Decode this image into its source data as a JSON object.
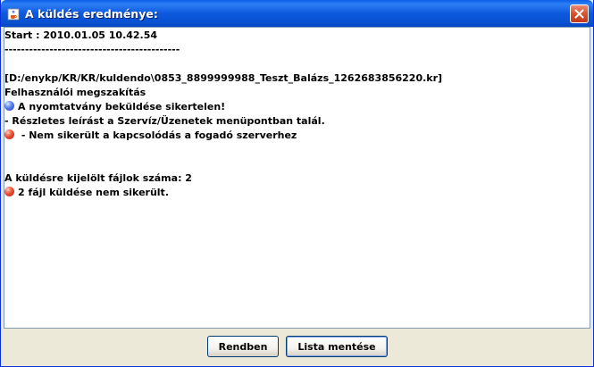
{
  "window": {
    "title": "A küldés eredménye:"
  },
  "log": {
    "lines": [
      {
        "text": "Start : 2010.01.05 10.42.54",
        "icon": null
      },
      {
        "text": "-------------------------------------------",
        "icon": null
      },
      {
        "text": "",
        "icon": null
      },
      {
        "text": "[D:/enykp/KR/KR/kuldendo\\0853_8899999988_Teszt_Balázs_1262683856220.kr]",
        "icon": null
      },
      {
        "text": "Felhasználói megszakítás",
        "icon": null
      },
      {
        "text": "A nyomtatvány beküldése sikertelen!",
        "icon": "blue-dot"
      },
      {
        "text": " - Részletes leírást a Szervíz/Üzenetek menüpontban talál.",
        "icon": null
      },
      {
        "text": "  - Nem sikerült a kapcsolódás a fogadó szerverhez",
        "icon": "red-dot"
      },
      {
        "text": "",
        "icon": null
      },
      {
        "text": "",
        "icon": null
      },
      {
        "text": "A küldésre kijelölt fájlok száma: 2",
        "icon": null
      },
      {
        "text": "2 fájl küldése nem sikerült.",
        "icon": "red-dot"
      }
    ]
  },
  "buttons": {
    "ok_label": "Rendben",
    "save_list_label": "Lista mentése"
  },
  "colors": {
    "blue_status": "#3F66E0",
    "red_status": "#E0391C",
    "titlebar": "#0A5FE8"
  }
}
